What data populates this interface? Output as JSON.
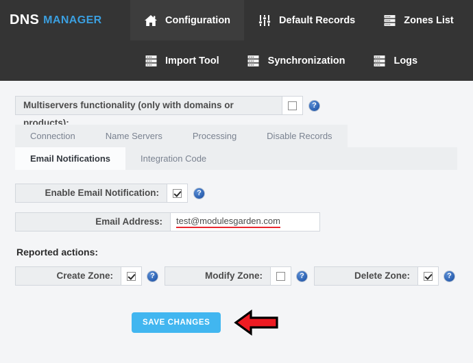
{
  "header": {
    "logo_primary": "DNS",
    "logo_secondary": "MANAGER",
    "nav_primary": [
      {
        "label": "Configuration",
        "icon": "home-icon",
        "active": true
      },
      {
        "label": "Default Records",
        "icon": "sliders-icon",
        "active": false
      },
      {
        "label": "Zones List",
        "icon": "server-list-icon",
        "active": false
      }
    ],
    "nav_secondary": [
      {
        "label": "Import Tool",
        "icon": "server-list-icon",
        "active": false
      },
      {
        "label": "Synchronization",
        "icon": "server-list-icon",
        "active": false
      },
      {
        "label": "Logs",
        "icon": "server-list-icon",
        "active": false
      }
    ]
  },
  "multiservers": {
    "label": "Multiservers functionality (only with domains or products):",
    "checked": false,
    "help": "?"
  },
  "tabs": [
    {
      "label": "Connection",
      "active": false
    },
    {
      "label": "Name Servers",
      "active": false
    },
    {
      "label": "Processing",
      "active": false
    },
    {
      "label": "Disable Records",
      "active": false
    },
    {
      "label": "Email Notifications",
      "active": true
    },
    {
      "label": "Integration Code",
      "active": false
    }
  ],
  "form": {
    "enable_label": "Enable Email Notification:",
    "enable_checked": true,
    "email_label": "Email Address:",
    "email_value": "test@modulesgarden.com",
    "email_placeholder": "Email Address",
    "help": "?"
  },
  "reported_actions": {
    "title": "Reported actions:",
    "items": [
      {
        "label": "Create Zone:",
        "checked": true,
        "help": "?"
      },
      {
        "label": "Modify Zone:",
        "checked": false,
        "help": "?"
      },
      {
        "label": "Delete Zone:",
        "checked": true,
        "help": "?"
      }
    ]
  },
  "footer": {
    "save_label": "SAVE CHANGES"
  },
  "colors": {
    "header_bg": "#343434",
    "logo_accent": "#3b9fe0",
    "save_button": "#41b6f0",
    "arrow_red": "#ee1b22",
    "underline_red": "#e8262d",
    "page_bg": "#f4f5f7",
    "label_bg": "#eceef0"
  }
}
